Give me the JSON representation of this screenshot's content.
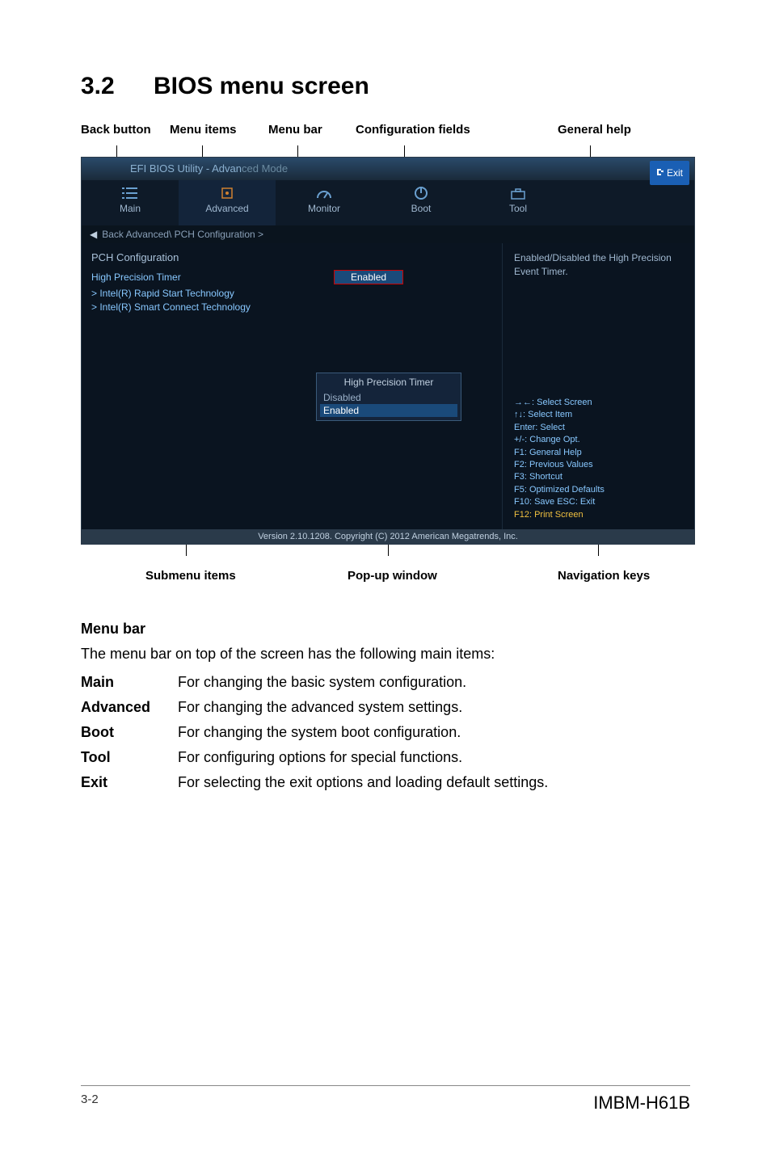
{
  "section": {
    "number": "3.2",
    "title": "BIOS menu screen"
  },
  "callouts_top": {
    "back": "Back button",
    "items": "Menu items",
    "bar": "Menu bar",
    "fields": "Configuration fields",
    "help": "General help"
  },
  "callouts_bottom": {
    "submenu": "Submenu items",
    "popup": "Pop-up window",
    "nav": "Navigation keys"
  },
  "bios": {
    "title_prefix": "EFI BIOS Utility - Advan",
    "title_suffix": "ced Mode",
    "exit": "Exit",
    "menu": {
      "main": "Main",
      "advanced": "Advanced",
      "monitor": "Monitor",
      "boot": "Boot",
      "tool": "Tool"
    },
    "breadcrumb": "Back   Advanced\\ PCH Configuration >",
    "pch_heading": "PCH Configuration",
    "hpt_label": "High Precision Timer",
    "hpt_value": "Enabled",
    "sub1": "> Intel(R) Rapid Start Technology",
    "sub2": "> Intel(R) Smart Connect Technology",
    "popup": {
      "title": "High Precision Timer",
      "opt_disabled": "Disabled",
      "opt_enabled": "Enabled"
    },
    "help_text": "Enabled/Disabled the High Precision Event Timer.",
    "nav": {
      "l1": "→←: Select Screen",
      "l2": "↑↓: Select Item",
      "l3": "Enter: Select",
      "l4": "+/-: Change Opt.",
      "l5": "F1: General Help",
      "l6": "F2: Previous Values",
      "l7": "F3: Shortcut",
      "l8": "F5: Optimized Defaults",
      "l9": "F10: Save  ESC: Exit",
      "l10": "F12: Print Screen"
    },
    "footer": "Version 2.10.1208. Copyright (C) 2012 American Megatrends, Inc."
  },
  "menubar_section": {
    "heading": "Menu bar",
    "desc": "The menu bar on top of the screen has the following main items:",
    "rows": [
      {
        "label": "Main",
        "desc": "For changing the basic system configuration."
      },
      {
        "label": "Advanced",
        "desc": "For changing the advanced system settings."
      },
      {
        "label": "Boot",
        "desc": "For changing the system boot configuration."
      },
      {
        "label": "Tool",
        "desc": "For configuring options for special functions."
      },
      {
        "label": "Exit",
        "desc": "For selecting the exit options and loading default settings."
      }
    ]
  },
  "page_footer": {
    "left": "3-2",
    "right": "IMBM-H61B"
  }
}
